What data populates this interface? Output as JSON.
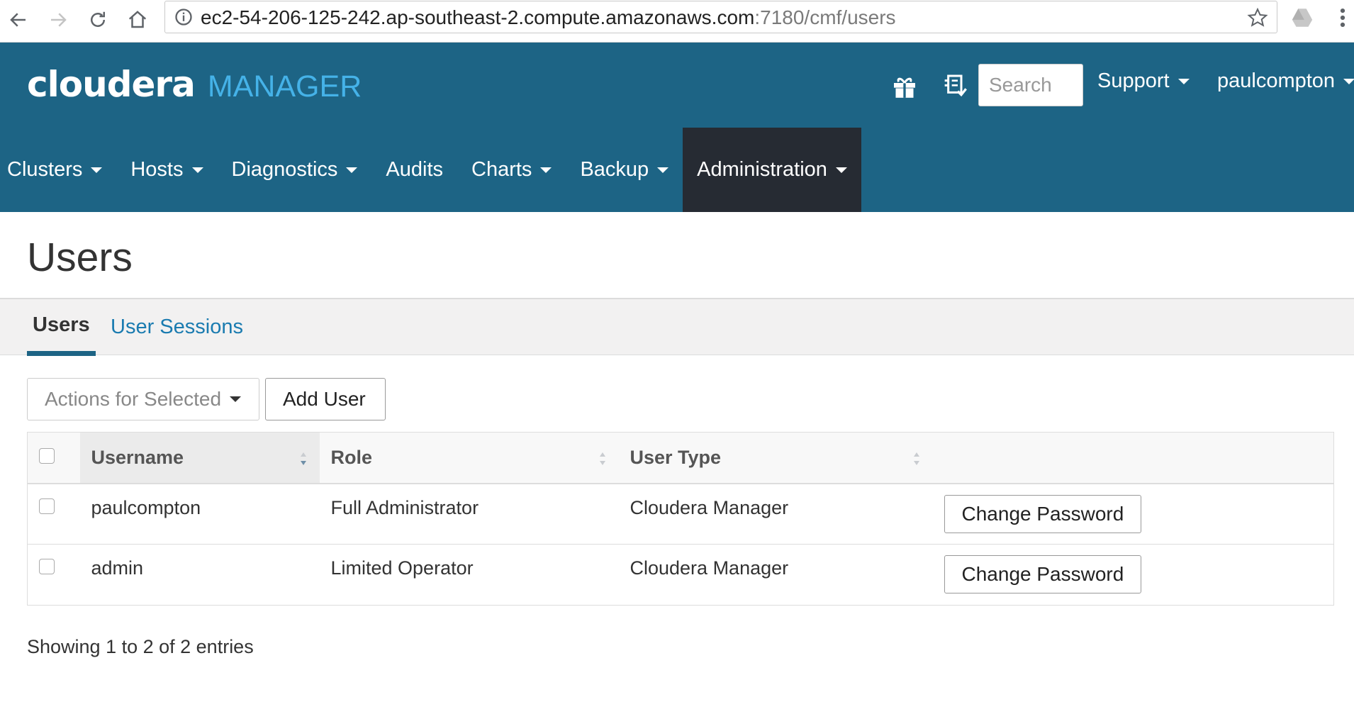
{
  "browser": {
    "url_host": "ec2-54-206-125-242.ap-southeast-2.compute.amazonaws.com",
    "url_path": ":7180/cmf/users",
    "icons": [
      "back-icon",
      "forward-icon",
      "reload-icon",
      "home-icon",
      "info-icon",
      "star-icon",
      "drive-icon",
      "menu-icon"
    ]
  },
  "header": {
    "logo_text": "cloudera",
    "logo_product": "MANAGER",
    "search_placeholder": "Search",
    "support_label": "Support",
    "user_label": "paulcompton",
    "icons": [
      "gift-icon",
      "running-commands-icon"
    ]
  },
  "nav": {
    "items": [
      {
        "label": "Clusters",
        "dropdown": true,
        "active": false
      },
      {
        "label": "Hosts",
        "dropdown": true,
        "active": false
      },
      {
        "label": "Diagnostics",
        "dropdown": true,
        "active": false
      },
      {
        "label": "Audits",
        "dropdown": false,
        "active": false
      },
      {
        "label": "Charts",
        "dropdown": true,
        "active": false
      },
      {
        "label": "Backup",
        "dropdown": true,
        "active": false
      },
      {
        "label": "Administration",
        "dropdown": true,
        "active": true
      }
    ]
  },
  "page": {
    "title": "Users",
    "tabs": [
      {
        "label": "Users",
        "active": true
      },
      {
        "label": "User Sessions",
        "active": false
      }
    ],
    "actions_label": "Actions for Selected",
    "add_user_label": "Add User",
    "table": {
      "columns": [
        "Username",
        "Role",
        "User Type"
      ],
      "rows": [
        {
          "username": "paulcompton",
          "role": "Full Administrator",
          "user_type": "Cloudera Manager",
          "action": "Change Password"
        },
        {
          "username": "admin",
          "role": "Limited Operator",
          "user_type": "Cloudera Manager",
          "action": "Change Password"
        }
      ]
    },
    "footer_info": "Showing 1 to 2 of 2 entries"
  },
  "colors": {
    "header_bg": "#1d6485",
    "active_nav_bg": "#262b33",
    "manager_text": "#45b2e8",
    "link": "#1a7bb0"
  }
}
